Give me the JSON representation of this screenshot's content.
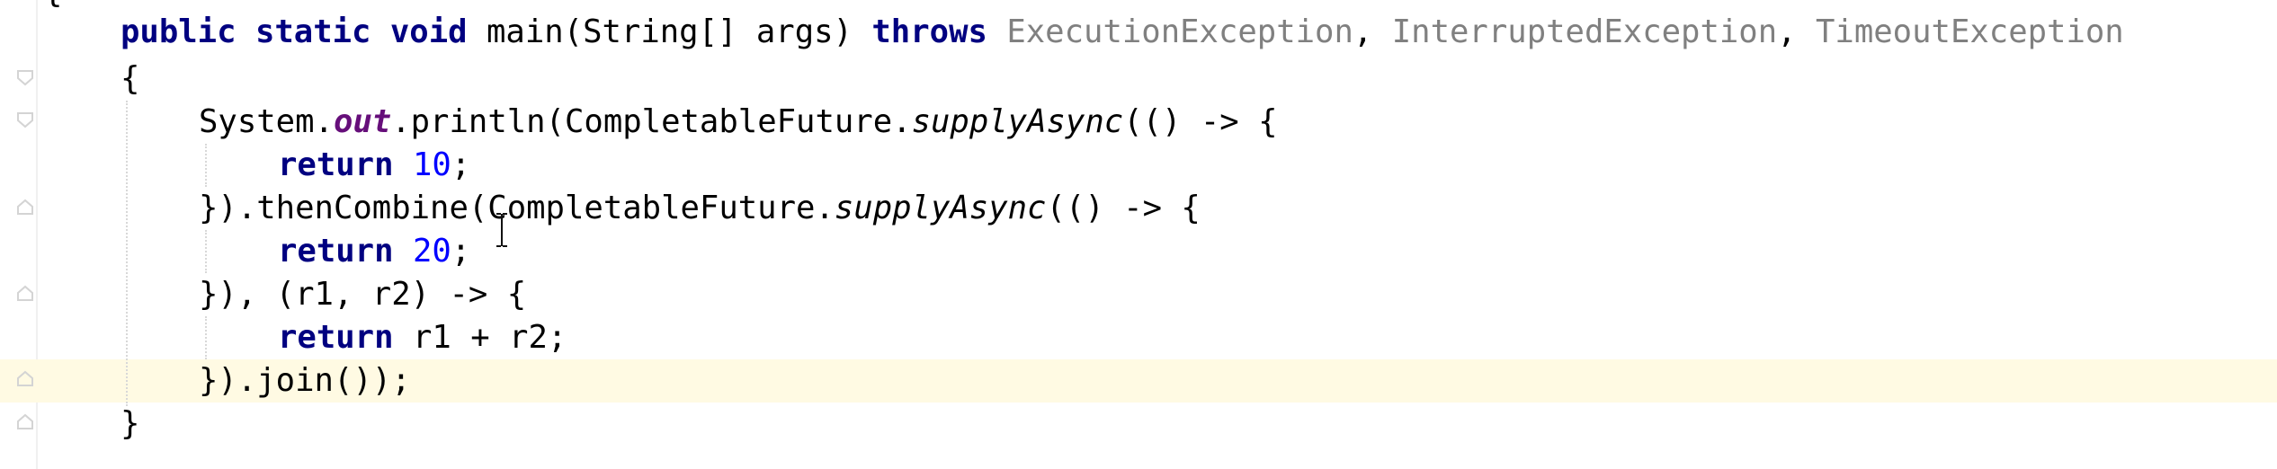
{
  "editor": {
    "top_brace": "{",
    "lines": [
      {
        "segments": [
          {
            "text": "public static void",
            "style": "kw"
          },
          {
            "text": " main(String[] args) ",
            "style": "plain"
          },
          {
            "text": "throws",
            "style": "kw"
          },
          {
            "text": " ",
            "style": "plain"
          },
          {
            "text": "ExecutionException",
            "style": "muted"
          },
          {
            "text": ", ",
            "style": "plain"
          },
          {
            "text": "InterruptedException",
            "style": "muted"
          },
          {
            "text": ", ",
            "style": "plain"
          },
          {
            "text": "TimeoutException",
            "style": "muted"
          }
        ]
      },
      {
        "segments": [
          {
            "text": "{",
            "style": "plain"
          }
        ]
      },
      {
        "segments": [
          {
            "text": "System.",
            "style": "plain"
          },
          {
            "text": "out",
            "style": "static-field"
          },
          {
            "text": ".println(CompletableFuture.",
            "style": "plain"
          },
          {
            "text": "supplyAsync",
            "style": "static-call"
          },
          {
            "text": "(() -> {",
            "style": "plain"
          }
        ]
      },
      {
        "segments": [
          {
            "text": "return",
            "style": "kw"
          },
          {
            "text": " ",
            "style": "plain"
          },
          {
            "text": "10",
            "style": "num"
          },
          {
            "text": ";",
            "style": "plain"
          }
        ]
      },
      {
        "segments": [
          {
            "text": "}).thenCombine(CompletableFuture.",
            "style": "plain"
          },
          {
            "text": "supplyAsync",
            "style": "static-call"
          },
          {
            "text": "(() -> {",
            "style": "plain"
          }
        ]
      },
      {
        "segments": [
          {
            "text": "return",
            "style": "kw"
          },
          {
            "text": " ",
            "style": "plain"
          },
          {
            "text": "20",
            "style": "num"
          },
          {
            "text": ";",
            "style": "plain"
          }
        ]
      },
      {
        "segments": [
          {
            "text": "}), (r1, r2) -> {",
            "style": "plain"
          }
        ]
      },
      {
        "segments": [
          {
            "text": "return",
            "style": "kw"
          },
          {
            "text": " r1 + r2;",
            "style": "plain"
          }
        ]
      },
      {
        "segments": [
          {
            "text": "}).join());",
            "style": "plain"
          }
        ]
      },
      {
        "segments": [
          {
            "text": "}",
            "style": "plain"
          }
        ]
      }
    ]
  },
  "colors": {
    "keyword": "#000080",
    "number": "#0000ff",
    "static_field": "#660e7a",
    "muted_type": "#808080",
    "current_line": "#fffae3"
  },
  "icons": {
    "fold_marker": "fold-marker-icon",
    "text_cursor": "i-beam-cursor-icon"
  }
}
